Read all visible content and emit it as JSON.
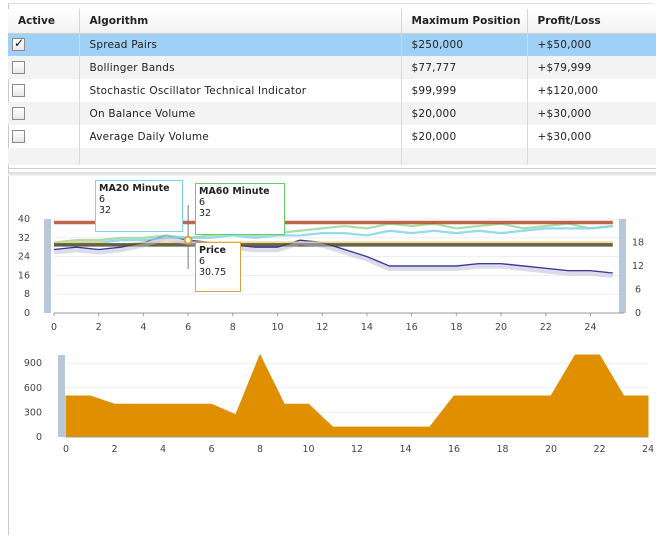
{
  "grid": {
    "columns": [
      "Active",
      "Algorithm",
      "Maximum Position",
      "Profit/Loss"
    ],
    "rows": [
      {
        "active": true,
        "algorithm": "Spread Pairs",
        "max_position": "$250,000",
        "pnl": "+$50,000"
      },
      {
        "active": false,
        "algorithm": "Bollinger Bands",
        "max_position": "$77,777",
        "pnl": "+$79,999"
      },
      {
        "active": false,
        "algorithm": "Stochastic Oscillator Technical Indicator",
        "max_position": "$99,999",
        "pnl": "+$120,000"
      },
      {
        "active": false,
        "algorithm": "On Balance Volume",
        "max_position": "$20,000",
        "pnl": "+$30,000"
      },
      {
        "active": false,
        "algorithm": "Average Daily Volume",
        "max_position": "$20,000",
        "pnl": "+$30,000"
      }
    ],
    "selected_row": 0
  },
  "tooltips": {
    "ma20": {
      "title": "MA20 Minute",
      "x": "6",
      "y": "32"
    },
    "ma60": {
      "title": "MA60 Minute",
      "x": "6",
      "y": "32"
    },
    "price": {
      "title": "Price",
      "x": "6",
      "y": "30.75"
    }
  },
  "colors": {
    "selected_row": "#9fd0f6",
    "volume": "#e08f00",
    "price_line": "#3a3a9a",
    "ma20_border": "#7fd3ea",
    "ma60_border": "#66cc66",
    "price_border": "#e0a040",
    "upper_band": "#b44a2c",
    "lower_band": "#4a4a2a",
    "axis_marker": "#b8c8d8"
  },
  "chart_data": [
    {
      "type": "line",
      "x": [
        0,
        1,
        2,
        3,
        4,
        5,
        6,
        7,
        8,
        9,
        10,
        11,
        12,
        13,
        14,
        15,
        16,
        17,
        18,
        19,
        20,
        21,
        22,
        23,
        24,
        25
      ],
      "xticks": [
        0,
        2,
        4,
        6,
        8,
        10,
        12,
        14,
        16,
        18,
        20,
        22,
        24
      ],
      "xlim": [
        0,
        25.5
      ],
      "ylim": [
        0,
        40
      ],
      "yticks_left": [
        0,
        8,
        16,
        24,
        32,
        40
      ],
      "ylim_right": [
        0,
        24
      ],
      "yticks_right": [
        0,
        6,
        12,
        18
      ],
      "series": [
        {
          "color": "#3a3a9a",
          "values": [
            27,
            28,
            27,
            28,
            30,
            33,
            31,
            30,
            29,
            28,
            28,
            31,
            30,
            27,
            24,
            20,
            20,
            20,
            20,
            21,
            21,
            20,
            19,
            18,
            18,
            17
          ]
        },
        {
          "color": "#9ad89a",
          "values": [
            30,
            31,
            31,
            32,
            32,
            33,
            32,
            33,
            34,
            33,
            34,
            35,
            36,
            37,
            36,
            38,
            37,
            38,
            36,
            37,
            38,
            36,
            37,
            38,
            36,
            37
          ]
        },
        {
          "color": "#7fd3ea",
          "values": [
            29,
            30,
            30,
            31,
            31,
            32,
            32,
            32,
            33,
            32,
            33,
            33,
            34,
            34,
            33,
            35,
            34,
            35,
            34,
            35,
            34,
            35,
            36,
            36,
            36,
            37
          ]
        },
        {
          "color": "#f0d080",
          "values": [
            30,
            30,
            30,
            29,
            30,
            30,
            30,
            30,
            30,
            30,
            30,
            30,
            30,
            30,
            30,
            30,
            30,
            30,
            30,
            30,
            30,
            30,
            30,
            30,
            30,
            30
          ]
        },
        {
          "color": "#b44a2c",
          "values": [
            38.5,
            38.5,
            38.5,
            38.5,
            38.5,
            38.5,
            38.5,
            38.5,
            38.5,
            38.5,
            38.5,
            38.5,
            38.5,
            38.5,
            38.5,
            38.5,
            38.5,
            38.5,
            38.5,
            38.5,
            38.5,
            38.5,
            38.5,
            38.5,
            38.5,
            38.5
          ]
        },
        {
          "color": "#4a4a2a",
          "values": [
            29,
            29,
            29,
            29,
            29,
            29,
            29,
            29,
            29,
            29,
            29,
            29,
            29,
            29,
            29,
            29,
            29,
            29,
            29,
            29,
            29,
            29,
            29,
            29,
            29,
            29
          ]
        }
      ]
    },
    {
      "type": "area",
      "x": [
        0,
        1,
        2,
        3,
        4,
        5,
        6,
        7,
        8,
        9,
        10,
        11,
        12,
        13,
        14,
        15,
        16,
        17,
        18,
        19,
        20,
        21,
        22,
        23,
        24
      ],
      "xticks": [
        0,
        2,
        4,
        6,
        8,
        10,
        12,
        14,
        16,
        18,
        20,
        22,
        24
      ],
      "xlim": [
        0,
        24
      ],
      "ylim": [
        0,
        1000
      ],
      "yticks": [
        0,
        300,
        600,
        900
      ],
      "series": [
        {
          "color": "#e08f00",
          "values": [
            500,
            500,
            400,
            400,
            400,
            400,
            400,
            270,
            1000,
            400,
            400,
            120,
            120,
            120,
            120,
            120,
            500,
            500,
            500,
            500,
            500,
            1000,
            1000,
            500,
            500
          ]
        }
      ]
    }
  ]
}
